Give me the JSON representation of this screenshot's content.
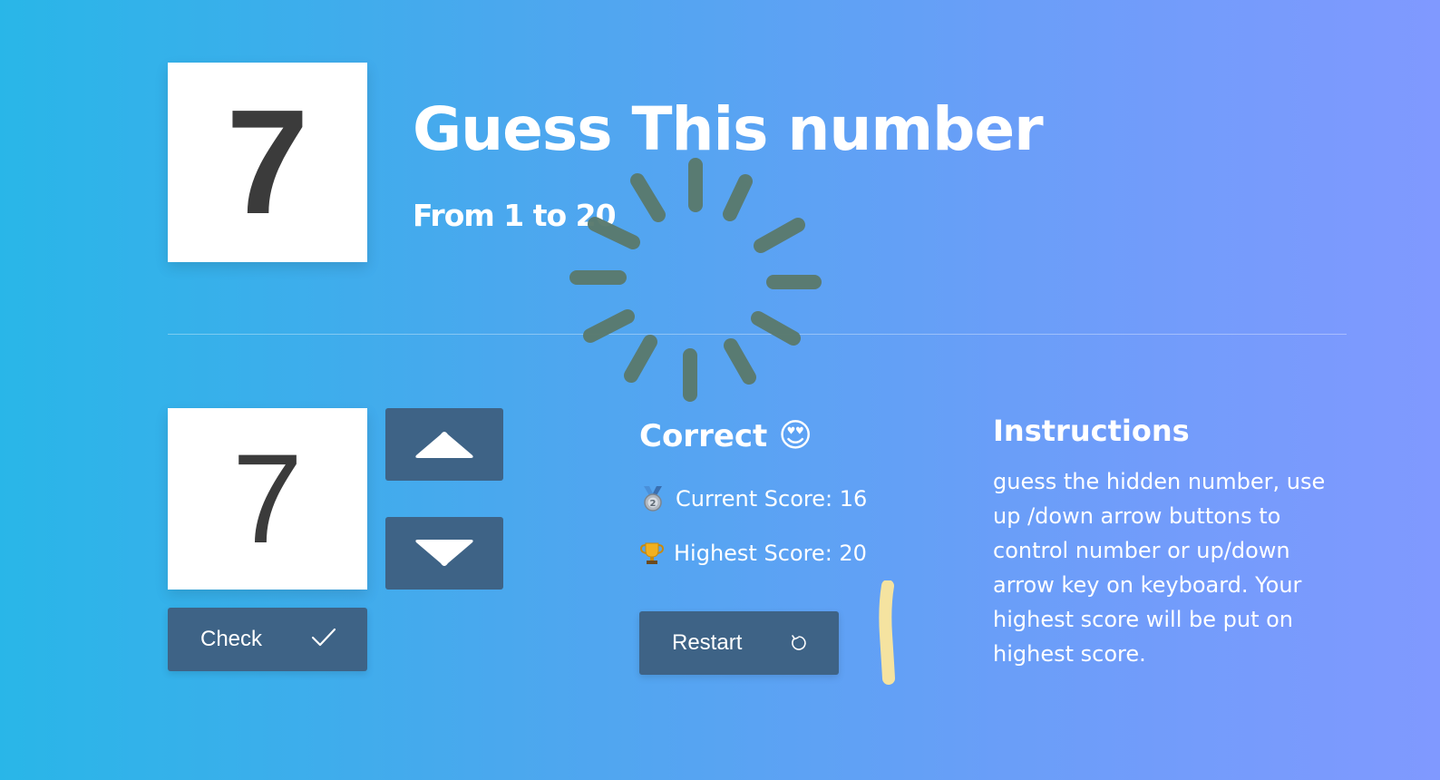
{
  "game": {
    "secret_number": "7",
    "title": "Guess This number",
    "range_text": "From 1 to 20"
  },
  "controls": {
    "guess_value": "7",
    "up_button": "up-arrow",
    "down_button": "down-arrow",
    "check_label": "Check"
  },
  "status": {
    "message": "Correct",
    "message_emoji": "😍",
    "current_score_label": "Current Score: 16",
    "current_score_icon": "medal-icon",
    "highest_score_label": "Highest Score: 20",
    "highest_score_icon": "trophy-icon",
    "restart_label": "Restart"
  },
  "instructions": {
    "title": "Instructions",
    "text": "guess the hidden number, use up /down arrow buttons to control number or up/down arrow key on keyboard. Your highest score will be put on highest score."
  },
  "colors": {
    "button": "#3e6386",
    "gradient_start": "#29b6e8",
    "gradient_end": "#8099ff",
    "spinner": "#5a7a6e",
    "highlight": "#f5e3a0"
  }
}
